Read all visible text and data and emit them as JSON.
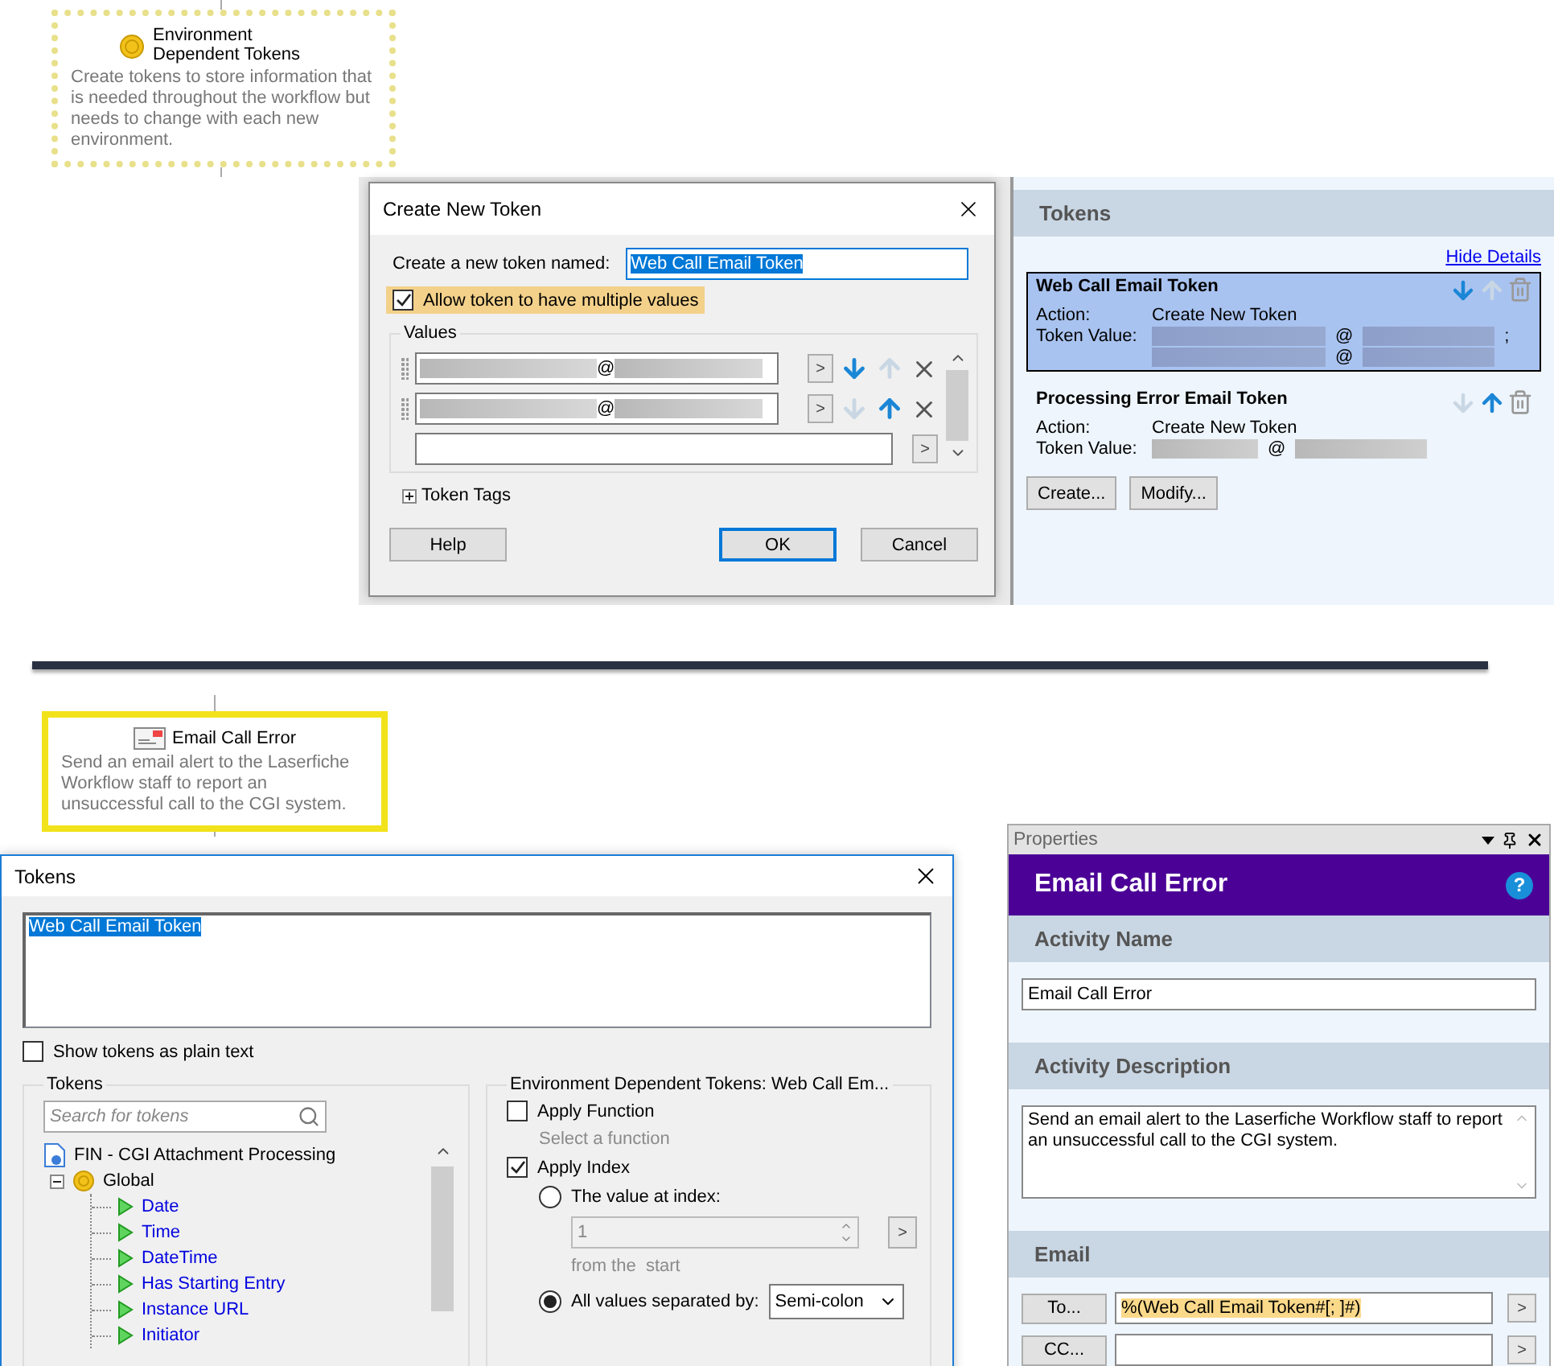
{
  "flow_nodes": [
    {
      "kind": "dashed",
      "title": "Environment Dependent Tokens",
      "description": "Create tokens to store information that is needed throughout the workflow but needs to change with each new environment."
    },
    {
      "kind": "highlighted",
      "title": "Email Call Error",
      "description": "Send an email alert to the Laserfiche Workflow staff to report an unsuccessful call to the CGI system."
    }
  ],
  "create_token_dialog": {
    "title": "Create New Token",
    "name_label": "Create a new token named:",
    "name_value": "Web Call Email Token",
    "multiple": {
      "label": "Allow token to have multiple values",
      "checked": true
    },
    "values_label": "Values",
    "go": ">",
    "values": [
      {
        "kind": "value",
        "text": "@",
        "can_move_down": true,
        "can_move_up": false
      },
      {
        "kind": "value",
        "text": "@",
        "can_move_down": false,
        "can_move_up": true
      },
      {
        "kind": "new"
      }
    ],
    "token_tags": "Token Tags",
    "buttons": [
      {
        "label": "Help",
        "default": false
      },
      {
        "label": "OK",
        "default": true
      },
      {
        "label": "Cancel",
        "default": false
      }
    ]
  },
  "tokens_panel": {
    "header": "Tokens",
    "link": "Hide Details",
    "tokens": [
      {
        "name": "Web Call Email Token",
        "selected": true,
        "action_label": "Action:",
        "action": "Create New Token",
        "value_label": "Token Value:",
        "values": [
          "@",
          "@"
        ],
        "separator": ";",
        "can_move_down": true,
        "can_move_up": false
      },
      {
        "name": "Processing Error Email Token",
        "selected": false,
        "action_label": "Action:",
        "action": "Create New Token",
        "value_label": "Token Value:",
        "values": [
          "@"
        ],
        "can_move_down": false,
        "can_move_up": true
      }
    ],
    "buttons": [
      "Create...",
      "Modify..."
    ]
  },
  "tokens_dialog": {
    "title": "Tokens",
    "expression": "Web Call Email Token",
    "plain_text": {
      "label": "Show tokens as plain text",
      "checked": false
    },
    "tokens_group": "Tokens",
    "search_placeholder": "Search for tokens",
    "tree": {
      "label": "FIN - CGI Attachment Processing",
      "children": [
        {
          "label": "Global",
          "expanded": true,
          "children": [
            {
              "label": "Date"
            },
            {
              "label": "Time"
            },
            {
              "label": "DateTime"
            },
            {
              "label": "Has Starting Entry"
            },
            {
              "label": "Instance URL"
            },
            {
              "label": "Initiator"
            }
          ]
        }
      ]
    },
    "env_group": "Environment Dependent Tokens: Web Call Em...",
    "apply_function": {
      "label": "Apply Function",
      "checked": false
    },
    "function_hint": "Select a function",
    "apply_index": {
      "label": "Apply Index",
      "checked": true
    },
    "options": [
      {
        "label": "The value at index:",
        "selected": false
      },
      {
        "label": "All values separated by:",
        "selected": true
      }
    ],
    "index_value": "1",
    "go": ">",
    "index_hint": "from the  start",
    "separator": "Semi-colon"
  },
  "properties": {
    "pane_title": "Properties",
    "title": "Email Call Error",
    "help": "?",
    "activity_name": {
      "heading": "Activity Name",
      "value": "Email Call Error"
    },
    "activity_description": {
      "heading": "Activity Description",
      "value": "Send an email alert to the Laserfiche Workflow staff to report an unsuccessful call to the CGI system."
    },
    "email": {
      "heading": "Email",
      "go": ">",
      "fields": [
        {
          "button": "To...",
          "value": "%(Web Call Email Token#[; ]#)",
          "highlighted": true
        },
        {
          "button": "CC..."
        }
      ]
    }
  }
}
